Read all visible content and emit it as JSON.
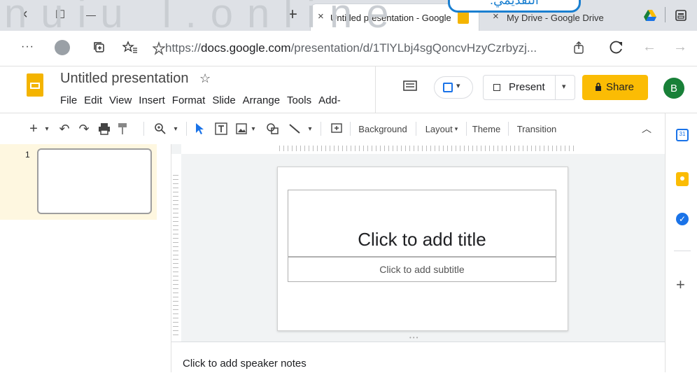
{
  "browser": {
    "active_tab_title": "Untitled presentation - Google S",
    "inactive_tab_title": "My Drive - Google Drive",
    "new_tab_label": "+",
    "url_prefix": "https://",
    "url_domain": "docs.google.com",
    "url_path": "/presentation/d/1TlYLbj4sgQoncvHzyCzrbyzj...",
    "close_glyph": "×",
    "restore_glyph": "☐",
    "minimize_glyph": "—",
    "more_glyph": "···"
  },
  "overlay": {
    "watermark": "nuiu l.online",
    "callout_text": "التقديمي."
  },
  "doc": {
    "title": "Untitled presentation",
    "star_glyph": "☆",
    "menus": [
      "File",
      "Edit",
      "View",
      "Insert",
      "Format",
      "Slide",
      "Arrange",
      "Tools",
      "Add-"
    ],
    "present_label": "Present",
    "share_label": "Share",
    "avatar_letter": "B"
  },
  "toolbar": {
    "background": "Background",
    "layout": "Layout",
    "theme": "Theme",
    "transition": "Transition"
  },
  "filmstrip": {
    "slide_number": "1"
  },
  "slide": {
    "title_placeholder": "Click to add title",
    "subtitle_placeholder": "Click to add subtitle"
  },
  "notes": {
    "placeholder": "Click to add speaker notes"
  },
  "colors": {
    "share": "#fbbc04",
    "avatar": "#188038",
    "slides_logo": "#f4b400",
    "accent_blue": "#1a73e8",
    "filmstrip_highlight": "#fef7e0"
  }
}
